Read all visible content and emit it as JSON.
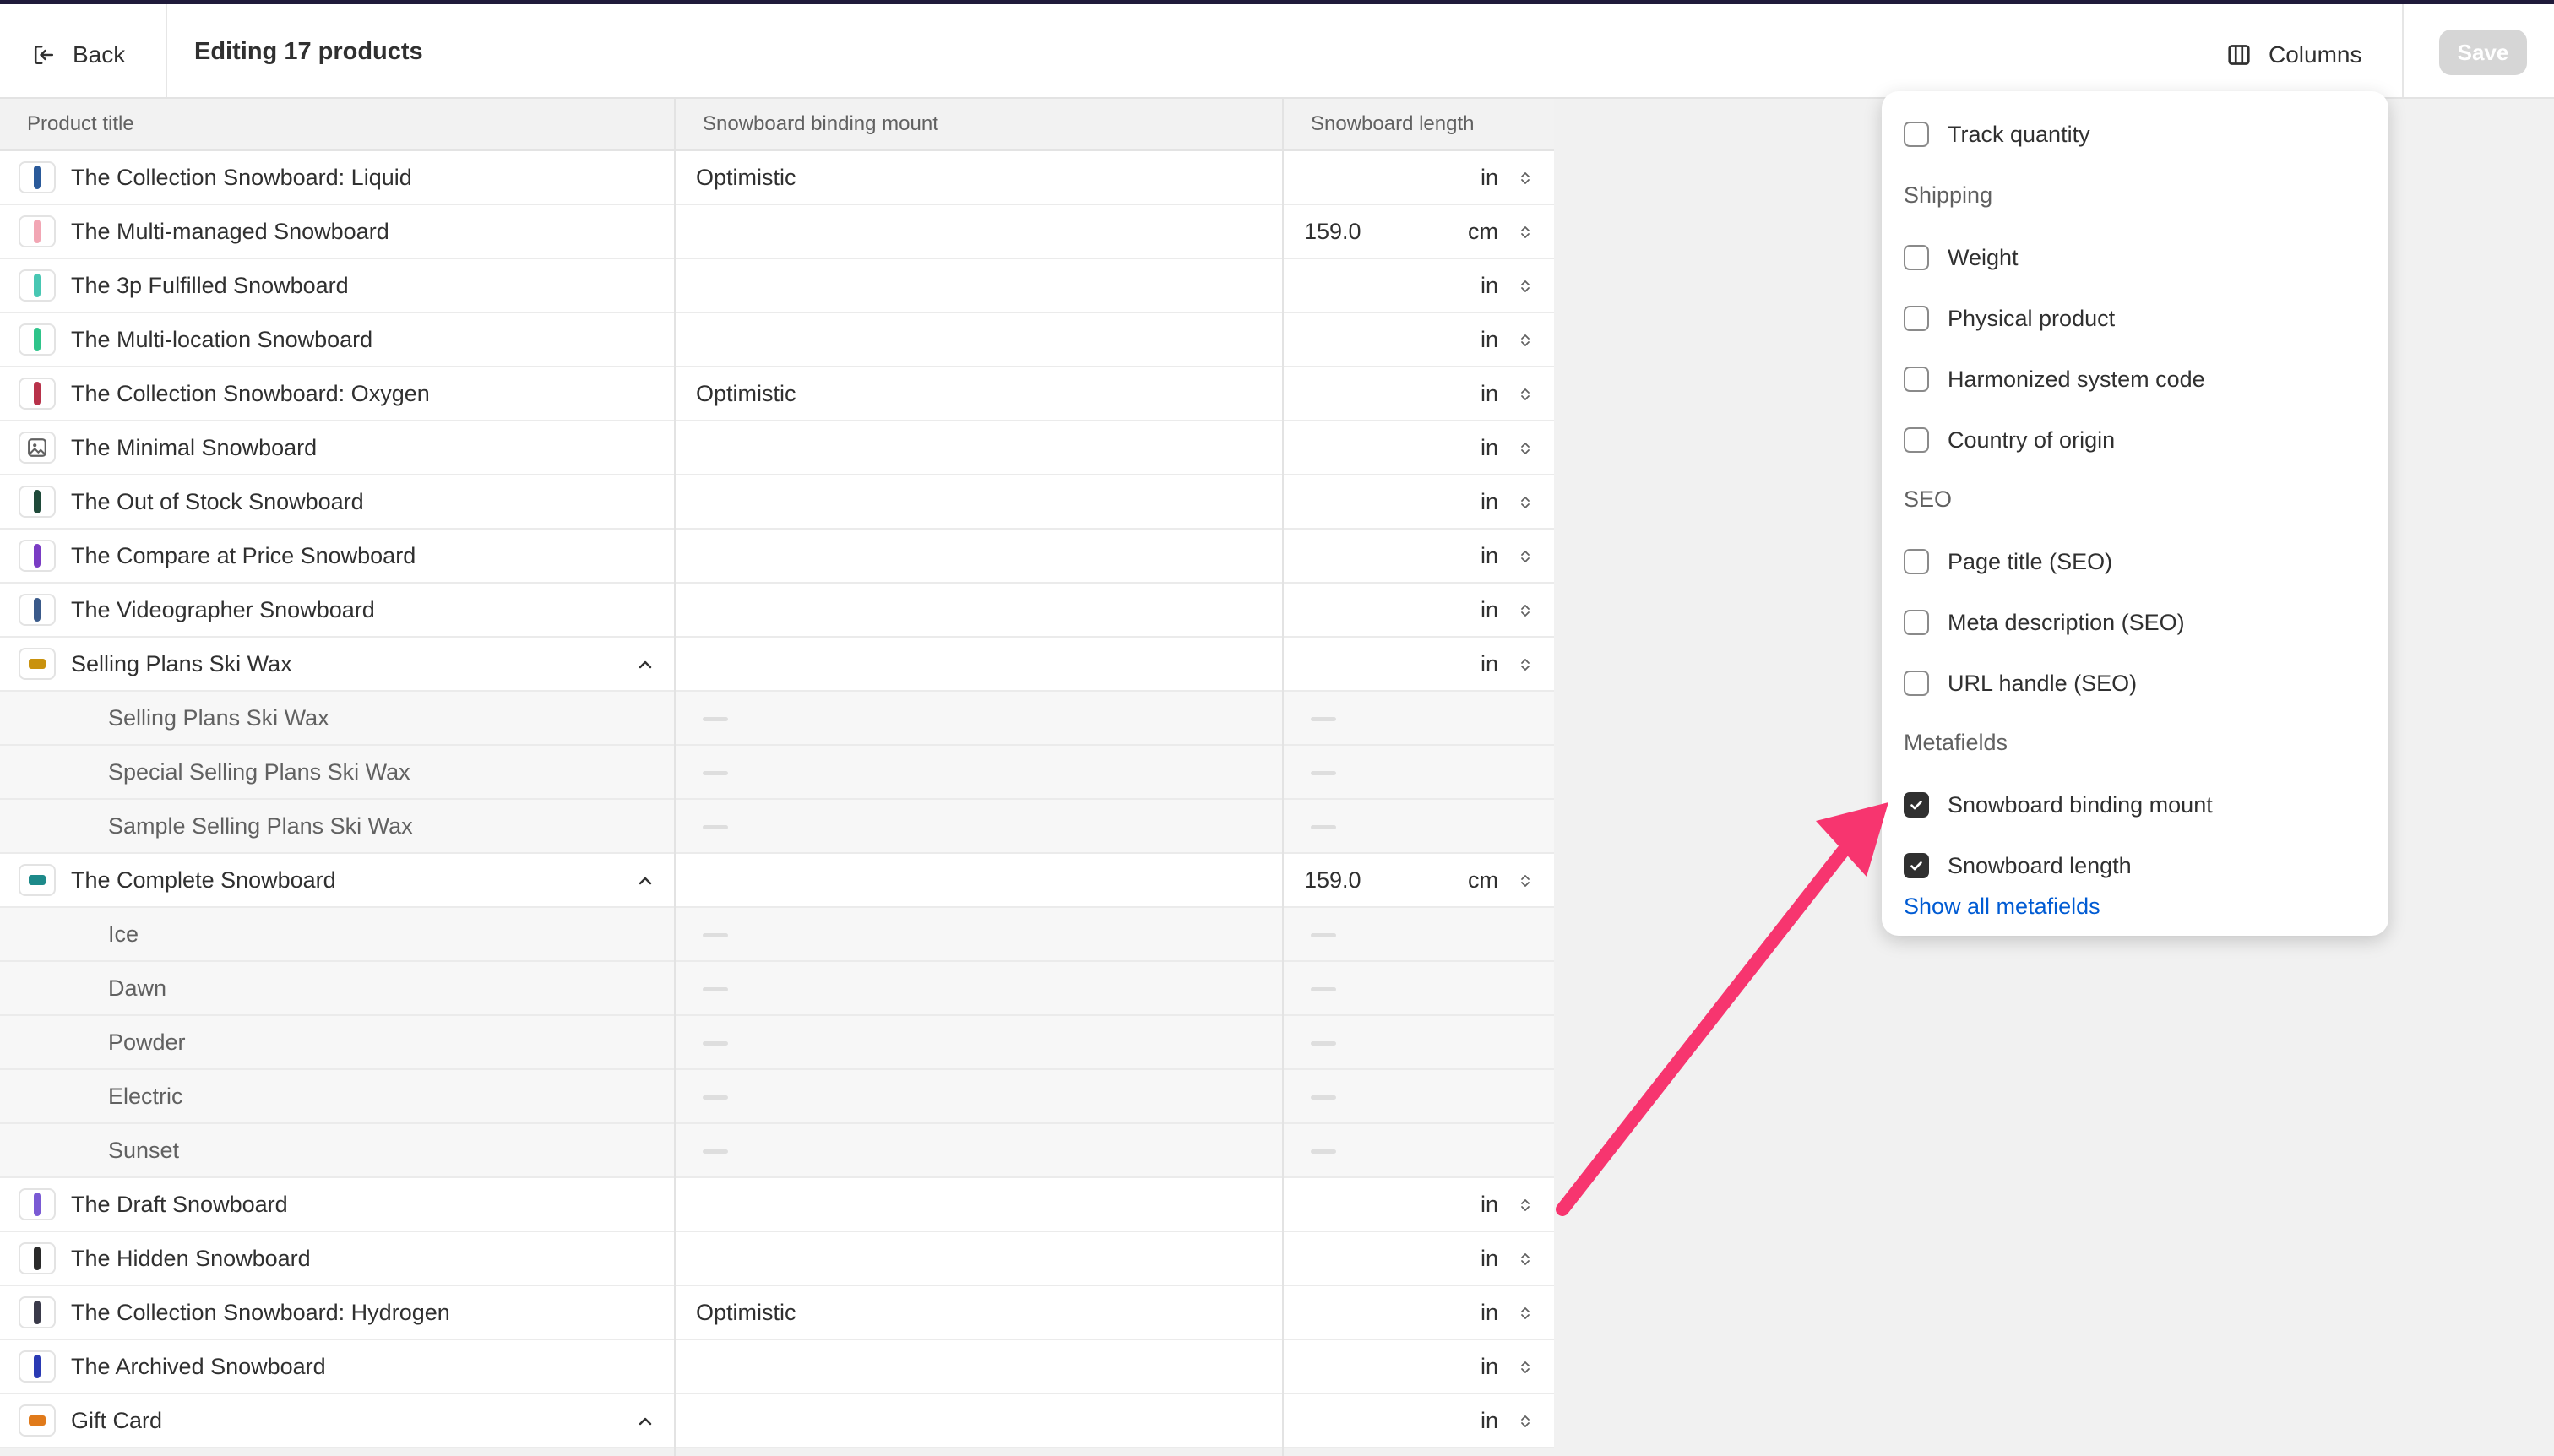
{
  "topbar": {
    "back_label": "Back",
    "title": "Editing 17 products",
    "columns_label": "Columns",
    "save_label": "Save"
  },
  "table": {
    "columns": [
      "Product title",
      "Snowboard binding mount",
      "Snowboard length"
    ]
  },
  "rows": [
    {
      "title": "The Collection Snowboard: Liquid",
      "mount": "Optimistic",
      "length": "",
      "unit": "in",
      "child": false,
      "group": false,
      "thumb": "#2a5a9a"
    },
    {
      "title": "The Multi-managed Snowboard",
      "mount": "",
      "length": "159.0",
      "unit": "cm",
      "child": false,
      "group": false,
      "thumb": "#f2a6b4"
    },
    {
      "title": "The 3p Fulfilled Snowboard",
      "mount": "",
      "length": "",
      "unit": "in",
      "child": false,
      "group": false,
      "thumb": "#48c7b3"
    },
    {
      "title": "The Multi-location Snowboard",
      "mount": "",
      "length": "",
      "unit": "in",
      "child": false,
      "group": false,
      "thumb": "#2ec48a"
    },
    {
      "title": "The Collection Snowboard: Oxygen",
      "mount": "Optimistic",
      "length": "",
      "unit": "in",
      "child": false,
      "group": false,
      "thumb": "#b8324a"
    },
    {
      "title": "The Minimal Snowboard",
      "mount": "",
      "length": "",
      "unit": "in",
      "child": false,
      "group": false,
      "thumb": "image-icon"
    },
    {
      "title": "The Out of Stock Snowboard",
      "mount": "",
      "length": "",
      "unit": "in",
      "child": false,
      "group": false,
      "thumb": "#1f4a3a"
    },
    {
      "title": "The Compare at Price Snowboard",
      "mount": "",
      "length": "",
      "unit": "in",
      "child": false,
      "group": false,
      "thumb": "#7a3cc4"
    },
    {
      "title": "The Videographer Snowboard",
      "mount": "",
      "length": "",
      "unit": "in",
      "child": false,
      "group": false,
      "thumb": "#3a5a8a"
    },
    {
      "title": "Selling Plans Ski Wax",
      "mount": "",
      "length": "",
      "unit": "in",
      "child": false,
      "group": true,
      "thumb": "#c9920e"
    },
    {
      "title": "Selling Plans Ski Wax",
      "mount": "",
      "length": "",
      "unit": "",
      "child": true,
      "group": false,
      "thumb": ""
    },
    {
      "title": "Special Selling Plans Ski Wax",
      "mount": "",
      "length": "",
      "unit": "",
      "child": true,
      "group": false,
      "thumb": ""
    },
    {
      "title": "Sample Selling Plans Ski Wax",
      "mount": "",
      "length": "",
      "unit": "",
      "child": true,
      "group": false,
      "thumb": ""
    },
    {
      "title": "The Complete Snowboard",
      "mount": "",
      "length": "159.0",
      "unit": "cm",
      "child": false,
      "group": true,
      "thumb": "#1d8a8a"
    },
    {
      "title": "Ice",
      "mount": "",
      "length": "",
      "unit": "",
      "child": true,
      "group": false,
      "thumb": ""
    },
    {
      "title": "Dawn",
      "mount": "",
      "length": "",
      "unit": "",
      "child": true,
      "group": false,
      "thumb": ""
    },
    {
      "title": "Powder",
      "mount": "",
      "length": "",
      "unit": "",
      "child": true,
      "group": false,
      "thumb": ""
    },
    {
      "title": "Electric",
      "mount": "",
      "length": "",
      "unit": "",
      "child": true,
      "group": false,
      "thumb": ""
    },
    {
      "title": "Sunset",
      "mount": "",
      "length": "",
      "unit": "",
      "child": true,
      "group": false,
      "thumb": ""
    },
    {
      "title": "The Draft Snowboard",
      "mount": "",
      "length": "",
      "unit": "in",
      "child": false,
      "group": false,
      "thumb": "#7a5ad4"
    },
    {
      "title": "The Hidden Snowboard",
      "mount": "",
      "length": "",
      "unit": "in",
      "child": false,
      "group": false,
      "thumb": "#2a2a2a"
    },
    {
      "title": "The Collection Snowboard: Hydrogen",
      "mount": "Optimistic",
      "length": "",
      "unit": "in",
      "child": false,
      "group": false,
      "thumb": "#3a3a4a"
    },
    {
      "title": "The Archived Snowboard",
      "mount": "",
      "length": "",
      "unit": "in",
      "child": false,
      "group": false,
      "thumb": "#2a3ab4"
    },
    {
      "title": "Gift Card",
      "mount": "",
      "length": "",
      "unit": "in",
      "child": false,
      "group": true,
      "thumb": "#e07a1a"
    }
  ],
  "columns_panel": {
    "items": [
      {
        "type": "option",
        "label": "Track quantity",
        "checked": false
      },
      {
        "type": "section",
        "label": "Shipping"
      },
      {
        "type": "option",
        "label": "Weight",
        "checked": false
      },
      {
        "type": "option",
        "label": "Physical product",
        "checked": false
      },
      {
        "type": "option",
        "label": "Harmonized system code",
        "checked": false
      },
      {
        "type": "option",
        "label": "Country of origin",
        "checked": false
      },
      {
        "type": "section",
        "label": "SEO"
      },
      {
        "type": "option",
        "label": "Page title (SEO)",
        "checked": false
      },
      {
        "type": "option",
        "label": "Meta description (SEO)",
        "checked": false
      },
      {
        "type": "option",
        "label": "URL handle (SEO)",
        "checked": false
      },
      {
        "type": "section",
        "label": "Metafields"
      },
      {
        "type": "option",
        "label": "Snowboard binding mount",
        "checked": true
      },
      {
        "type": "option",
        "label": "Snowboard length",
        "checked": true
      }
    ],
    "show_all_label": "Show all metafields"
  },
  "annotation": {
    "color": "#f7356f"
  }
}
